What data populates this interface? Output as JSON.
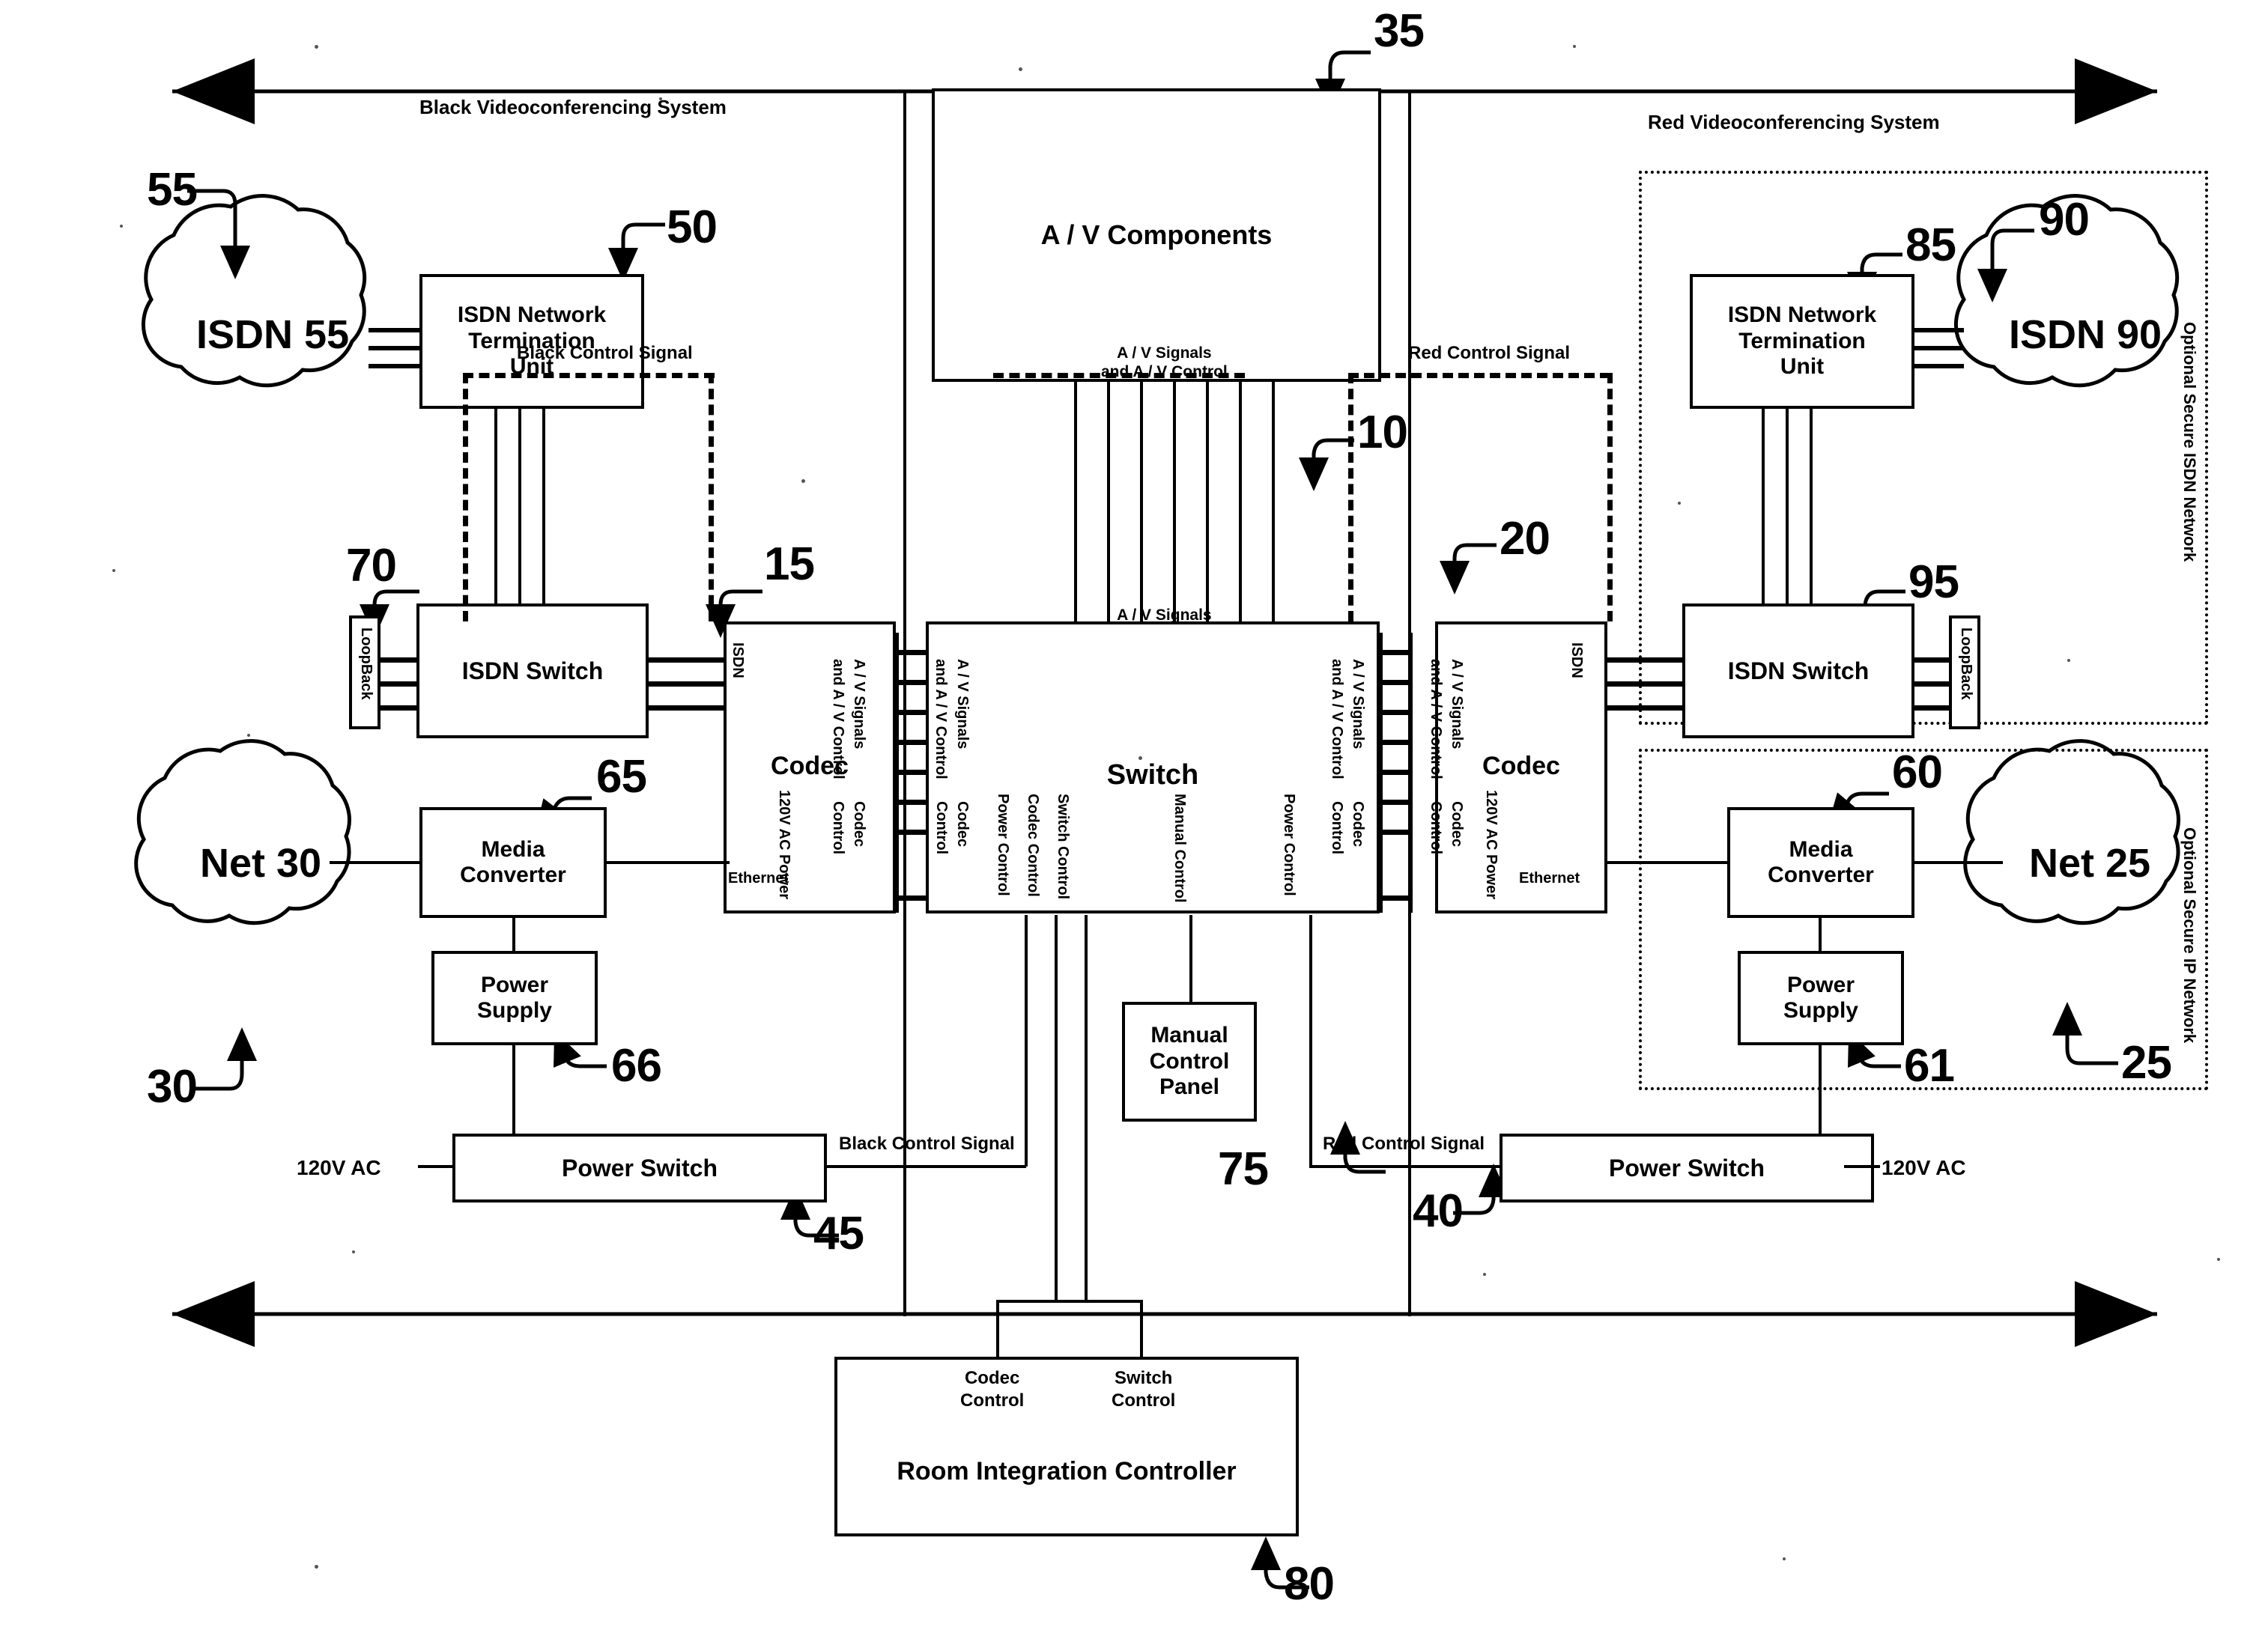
{
  "figure": {
    "system_labels": {
      "black_system": "Black Videoconferencing System",
      "red_system": "Red Videoconferencing System",
      "optional_isdn": "Optional Secure ISDN Network",
      "optional_ip": "Optional Secure IP Network"
    },
    "blocks": {
      "av_components": "A / V Components",
      "switch": "Switch",
      "codec_left": "Codec",
      "codec_right": "Codec",
      "isdn_ntu_left": "ISDN Network\nTermination\nUnit",
      "isdn_ntu_right": "ISDN Network\nTermination\nUnit",
      "isdn_switch_left": "ISDN Switch",
      "isdn_switch_right": "ISDN Switch",
      "loopback_left": "LoopBack",
      "loopback_right": "LoopBack",
      "media_converter_left": "Media\nConverter",
      "media_converter_right": "Media\nConverter",
      "power_supply_left": "Power\nSupply",
      "power_supply_right": "Power\nSupply",
      "power_switch_left": "Power Switch",
      "power_switch_right": "Power Switch",
      "manual_control_panel": "Manual\nControl\nPanel",
      "room_integration_controller": "Room Integration Controller"
    },
    "clouds": {
      "isdn_55": "ISDN 55",
      "isdn_90": "ISDN 90",
      "net_30": "Net 30",
      "net_25": "Net 25"
    },
    "signal_labels": {
      "av_signals_and_control": "A / V Signals\nand A / V Control",
      "av_signals_line1": "A / V Signals",
      "av_signals_line2": "and A / V Control",
      "black_control_signal": "Black Control Signal",
      "red_control_signal": "Red Control Signal",
      "codec_control": "Codec\nControl",
      "codec_control_line1": "Codec",
      "codec_control_line2": "Control",
      "switch_control_line1": "Switch",
      "switch_control_line2": "Control",
      "power_control": "Power Control",
      "switch_control": "Switch Control",
      "manual_control": "Manual Control",
      "codec_control_v": "Codec Control",
      "isdn_port": "ISDN",
      "ethernet_port": "Ethernet",
      "ac_power": "120V AC Power",
      "mains_left": "120V AC",
      "mains_right": "120V AC"
    },
    "reference_numerals": {
      "n10": "10",
      "n15": "15",
      "n20": "20",
      "n25": "25",
      "n30": "30",
      "n35": "35",
      "n40": "40",
      "n45": "45",
      "n50": "50",
      "n55": "55",
      "n60": "60",
      "n61": "61",
      "n65": "65",
      "n66": "66",
      "n70": "70",
      "n75": "75",
      "n80": "80",
      "n85": "85",
      "n90": "90",
      "n95": "95"
    },
    "colors": {
      "ink": "#000000",
      "paper": "#ffffff"
    }
  }
}
